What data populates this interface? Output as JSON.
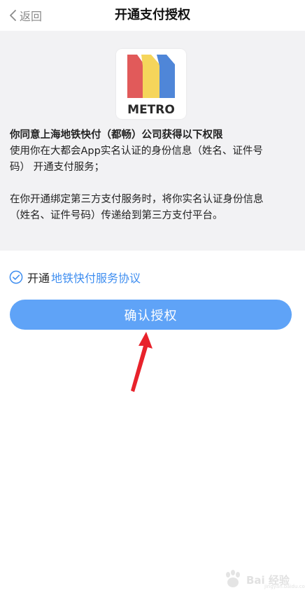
{
  "nav": {
    "back_label": "返回",
    "title": "开通支付授权"
  },
  "logo": {
    "text": "METRO",
    "colors": {
      "red": "#e15a5a",
      "yellow": "#f5d55b",
      "blue": "#4f86d8",
      "text": "#2a2a2a"
    }
  },
  "content": {
    "heading": "你同意上海地铁快付（都畅）公司获得以下权限",
    "line1": "使用你在大都会App实名认证的身份信息（姓名、证件号",
    "line2": "码） 开通支付服务；",
    "line3": "在你开通绑定第三方支付服务时，将你实名认证身份信息",
    "line4": "（姓名、证件号码）传递给到第三方支付平台。"
  },
  "agreement": {
    "prefix": "开通",
    "link": "地铁快付服务协议",
    "checked": true
  },
  "button": {
    "label": "确认授权"
  },
  "watermark": {
    "text": "Bai 经验",
    "sub": "jingyan.baidu.com"
  },
  "theme": {
    "accent": "#5fa3f7",
    "link": "#3f8ef0",
    "panel_bg": "#f2f2f4",
    "arrow": "#e8222b"
  }
}
